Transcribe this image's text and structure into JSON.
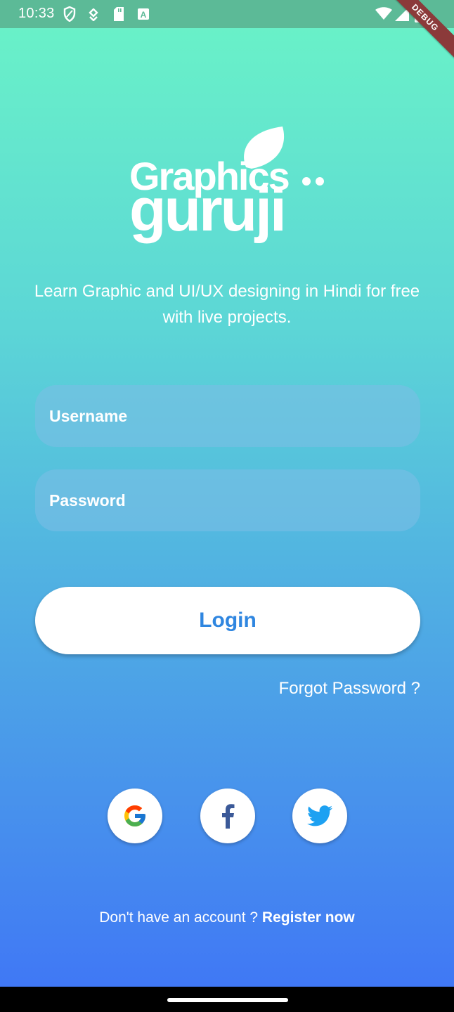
{
  "status_bar": {
    "time": "10:33",
    "left_icons": [
      "shield-icon",
      "notification-icon",
      "sd-card-icon",
      "keyboard-icon"
    ],
    "right_icons": [
      "wifi-icon",
      "signal-icon",
      "battery-icon"
    ],
    "debug_banner": "DEBUG"
  },
  "logo": {
    "line1": "Graphics",
    "line2": "guruji"
  },
  "tagline": "Learn Graphic and UI/UX designing in Hindi for free with live projects.",
  "form": {
    "username_placeholder": "Username",
    "password_placeholder": "Password"
  },
  "login_label": "Login",
  "forgot_password_label": "Forgot Password ?",
  "social": [
    {
      "name": "google",
      "icon": "google-icon"
    },
    {
      "name": "facebook",
      "icon": "facebook-icon"
    },
    {
      "name": "twitter",
      "icon": "twitter-icon"
    }
  ],
  "register": {
    "prompt": "Don't have an account ?",
    "link_label": "Register now"
  },
  "colors": {
    "gradient_top": "#6af3c7",
    "gradient_bottom": "#4078f5",
    "status_bar": "#5cba97",
    "login_text": "#2f86e0",
    "debug_ribbon": "#8b3a3a"
  }
}
